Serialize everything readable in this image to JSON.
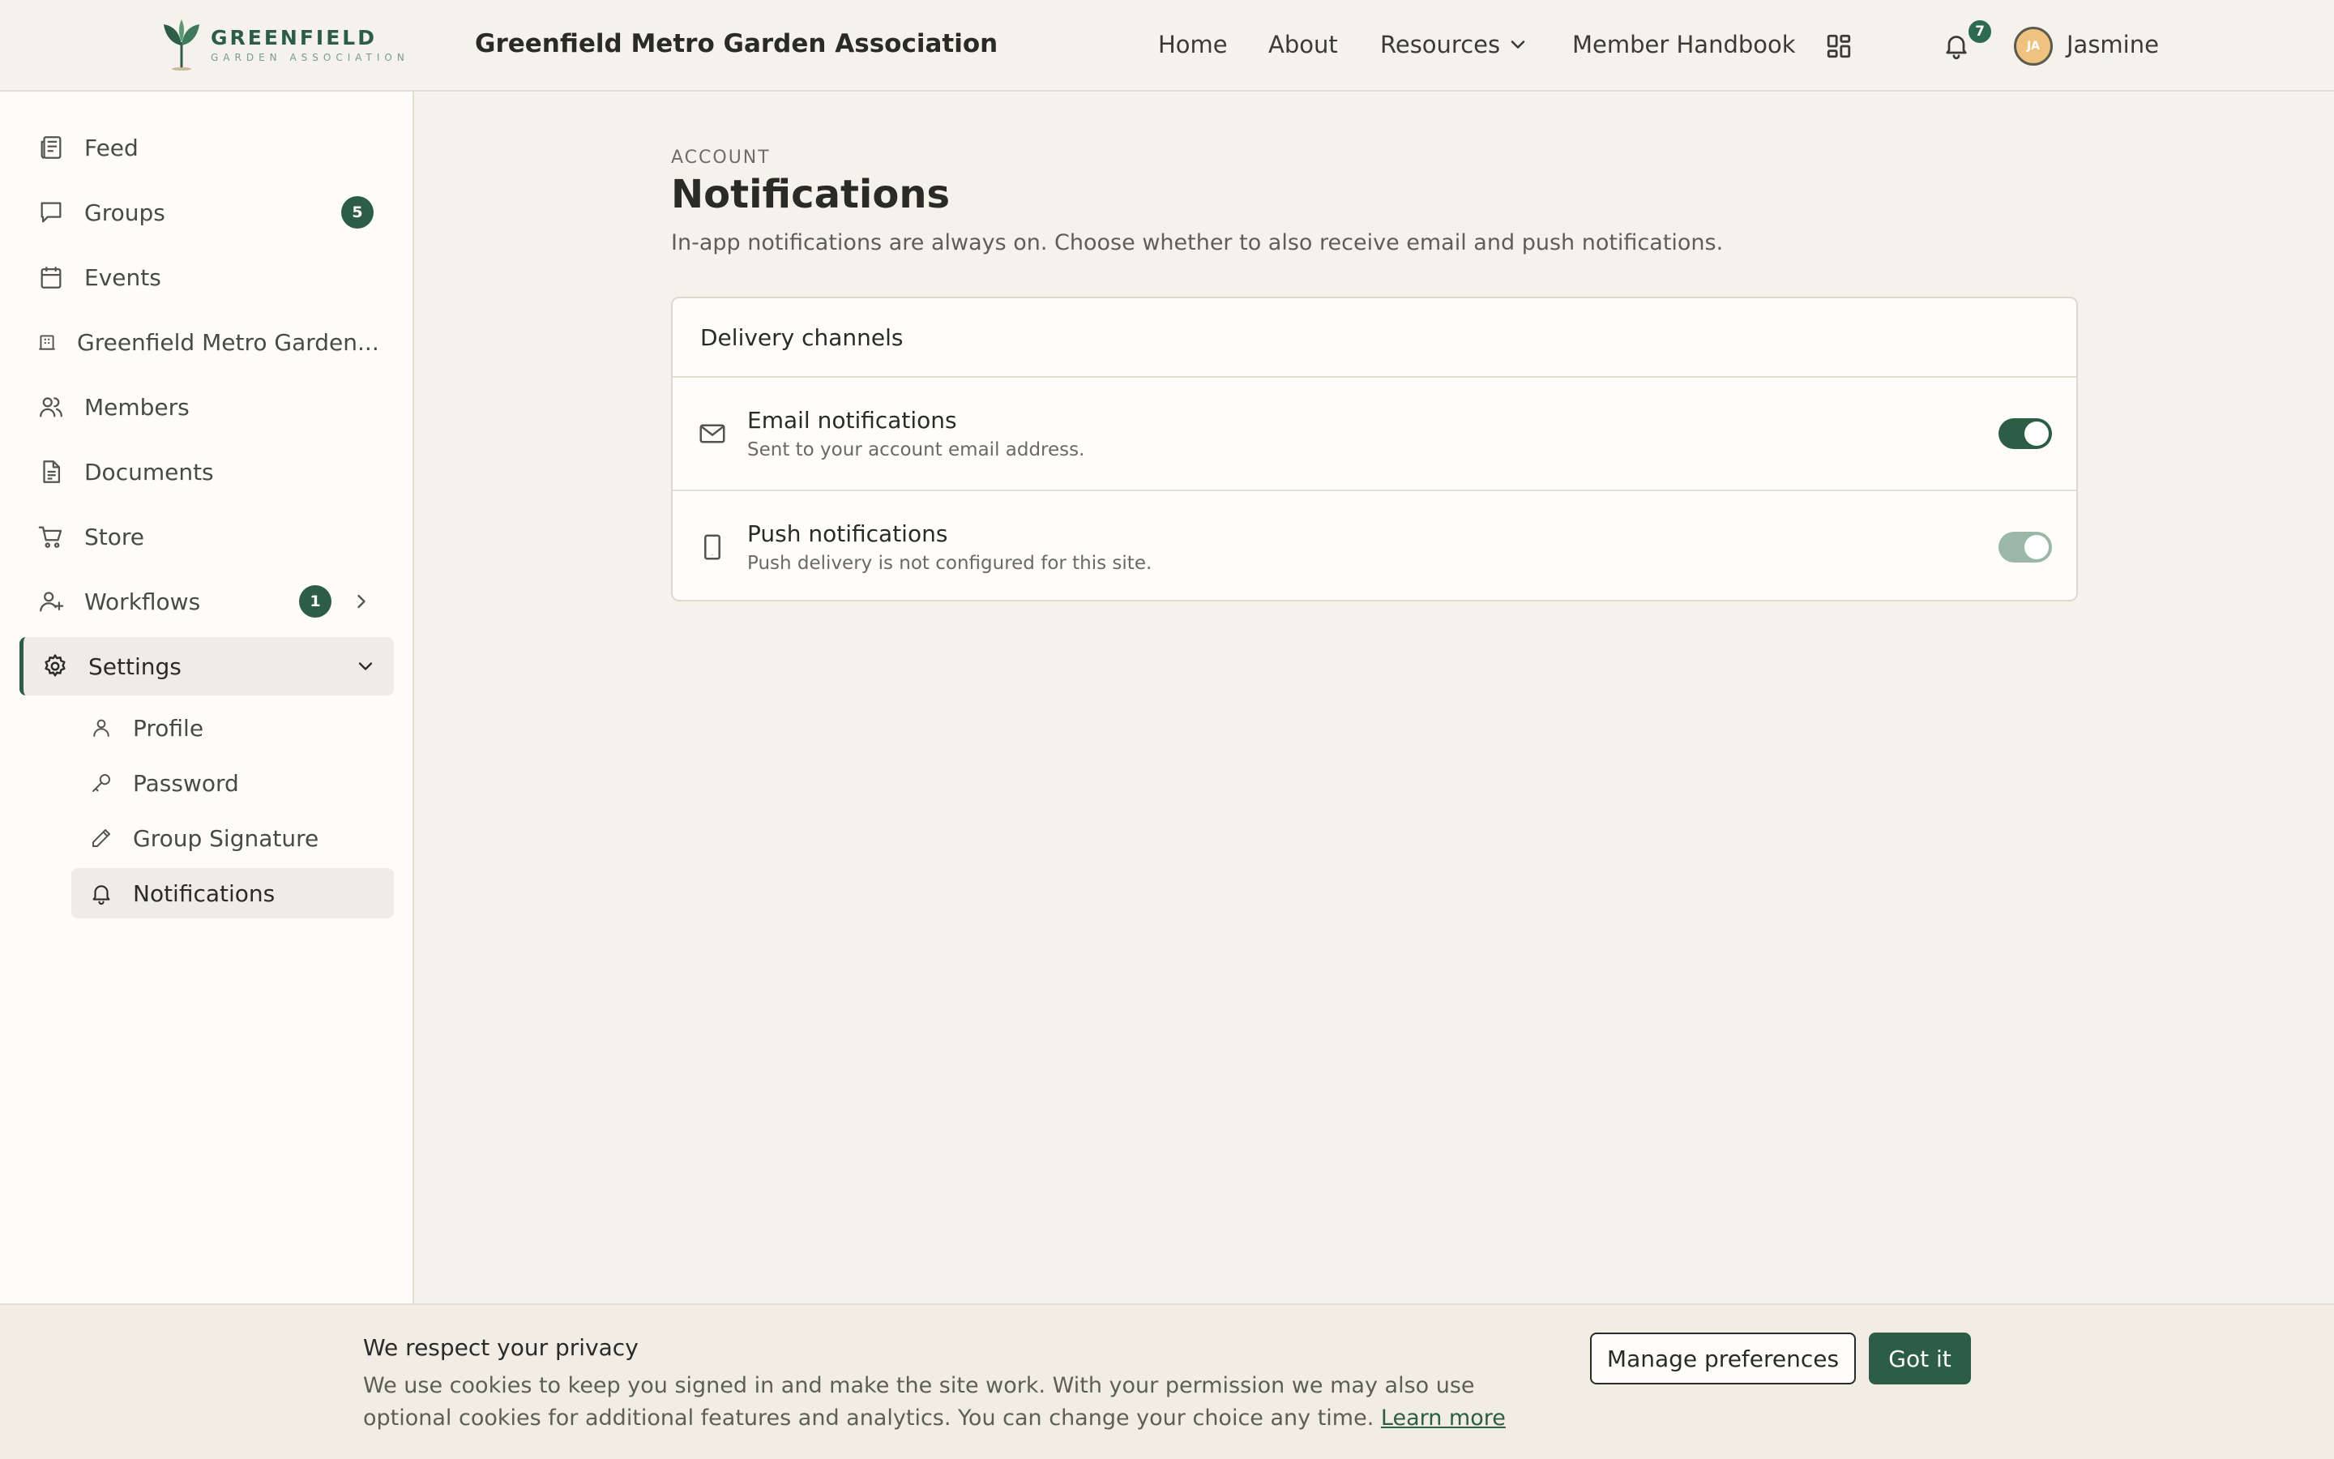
{
  "colors": {
    "brand": "#2d5e45",
    "background": "#f5f2ec",
    "toggle_disabled": "#9bb8a7",
    "avatar": "#f0c27f"
  },
  "header": {
    "logo": {
      "main": "GREENFIELD",
      "sub": "GARDEN ASSOCIATION"
    },
    "site_title": "Greenfield Metro Garden Association",
    "nav": {
      "home": "Home",
      "about": "About",
      "resources": "Resources",
      "handbook": "Member Handbook"
    },
    "notifications_count": "7",
    "user": {
      "initials": "JA",
      "name": "Jasmine"
    }
  },
  "sidebar": {
    "items": [
      {
        "label": "Feed",
        "icon": "newspaper-icon"
      },
      {
        "label": "Groups",
        "icon": "chat-bubble-icon",
        "badge": "5"
      },
      {
        "label": "Events",
        "icon": "calendar-icon"
      },
      {
        "label": "Greenfield Metro Garden...",
        "icon": "building-icon"
      },
      {
        "label": "Members",
        "icon": "users-icon"
      },
      {
        "label": "Documents",
        "icon": "document-icon"
      },
      {
        "label": "Store",
        "icon": "cart-icon"
      },
      {
        "label": "Workflows",
        "icon": "user-plus-icon",
        "badge": "1"
      },
      {
        "label": "Settings",
        "icon": "gear-icon"
      }
    ],
    "settings_sub": [
      {
        "label": "Profile",
        "icon": "user-icon"
      },
      {
        "label": "Password",
        "icon": "key-icon"
      },
      {
        "label": "Group Signature",
        "icon": "pen-icon"
      },
      {
        "label": "Notifications",
        "icon": "bell-icon"
      }
    ]
  },
  "main": {
    "eyebrow": "ACCOUNT",
    "title": "Notifications",
    "description": "In-app notifications are always on. Choose whether to also receive email and push notifications.",
    "card": {
      "header": "Delivery channels",
      "rows": [
        {
          "title": "Email notifications",
          "subtitle": "Sent to your account email address.",
          "enabled": true
        },
        {
          "title": "Push notifications",
          "subtitle": "Push delivery is not configured for this site.",
          "enabled": true,
          "disabled": true
        }
      ]
    }
  },
  "cookie": {
    "title": "We respect your privacy",
    "text": "We use cookies to keep you signed in and make the site work. With your permission we may also use optional cookies for additional features and analytics. You can change your choice any time.",
    "link": "Learn more",
    "manage": "Manage preferences",
    "accept": "Got it"
  }
}
